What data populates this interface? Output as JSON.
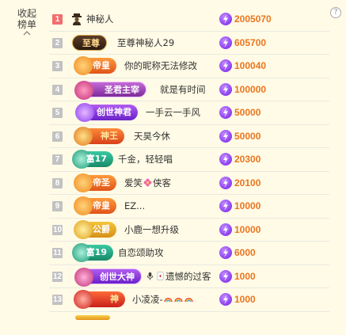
{
  "panel": {
    "collapse_label_1": "收起",
    "collapse_label_2": "榜单"
  },
  "help_label": "?",
  "colors": {
    "score": "#ea7520",
    "top_rank": "#f36e6e",
    "rank": "#c2c2c2",
    "background": "#fffbe6"
  },
  "rows": [
    {
      "rank": "1",
      "badge": "",
      "name": "神秘人",
      "score": "2005070"
    },
    {
      "rank": "2",
      "badge": "至尊",
      "name": "至尊神秘人29",
      "score": "605700"
    },
    {
      "rank": "3",
      "badge": "帝皇",
      "name": "你的昵称无法修改",
      "score": "100040"
    },
    {
      "rank": "4",
      "badge": "圣君主宰",
      "name": "就是有时间",
      "score": "100000"
    },
    {
      "rank": "5",
      "badge": "创世神君",
      "name": "一手云一手风",
      "score": "50000"
    },
    {
      "rank": "6",
      "badge": "神王",
      "name": "天昊今休",
      "score": "50000"
    },
    {
      "rank": "7",
      "badge": "富17",
      "name": "千金，轻轻唱",
      "score": "20300"
    },
    {
      "rank": "8",
      "badge": "帝圣",
      "name_parts": [
        "爱笑",
        "侠客"
      ],
      "score": "20100"
    },
    {
      "rank": "9",
      "badge": "帝皇",
      "name": "EZ...",
      "score": "10000"
    },
    {
      "rank": "10",
      "badge": "公爵",
      "name": "小鹿一想升级",
      "score": "10000"
    },
    {
      "rank": "11",
      "badge": "富19",
      "name": "自恋颂助攻",
      "score": "6000"
    },
    {
      "rank": "12",
      "badge": "创世大神",
      "name": "遗憾的过客",
      "score": "1000"
    },
    {
      "rank": "13",
      "badge": "神",
      "name": "小凌凌-",
      "score": "1000"
    }
  ]
}
